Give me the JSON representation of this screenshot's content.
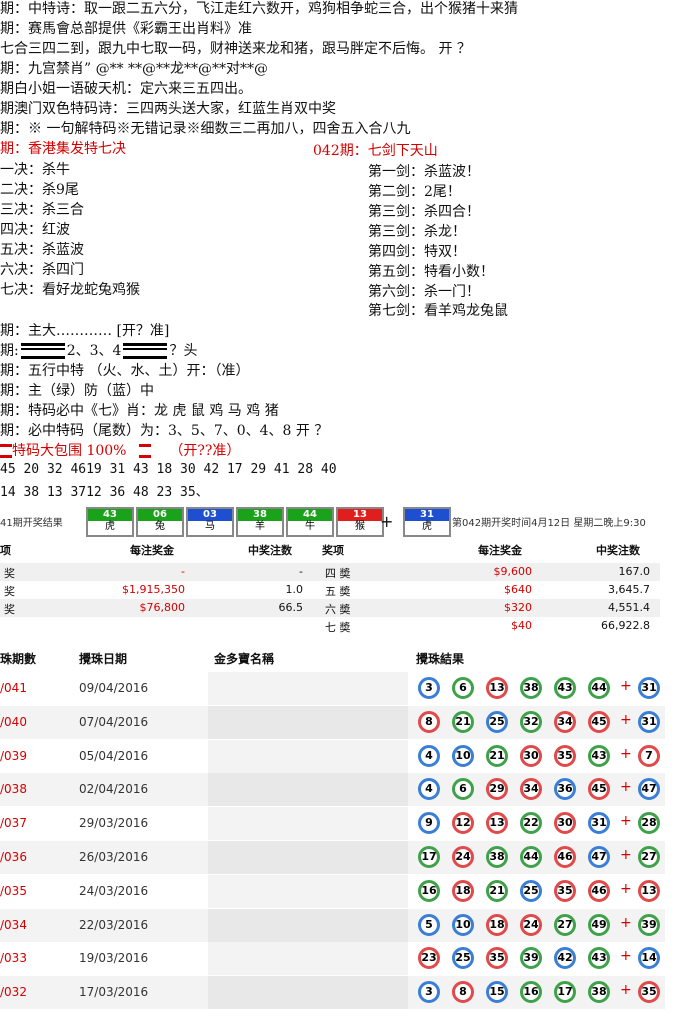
{
  "prediction_lines": [
    {
      "text": "期：中特诗：取一跟二五六分，飞江走红六数开，鸡狗相争蛇三合，出个猴猪十来猜",
      "red": false
    },
    {
      "text": "期：赛馬會总部提供《彩霸王出肖料》准",
      "red": false
    },
    {
      "text": "七合三四二到，跟九中七取一码，财神送来龙和猪，跟马胖定不后悔。 开 ？",
      "red": false
    },
    {
      "text": "期：九宫禁肖” @** **@**龙**@**对**@",
      "red": false
    },
    {
      "text": "期白小姐一语破天机：定六来三五四出。",
      "red": false
    },
    {
      "text": "期澳门双色特码诗：三四两头送大家，红蓝生肖双中奖",
      "red": false
    },
    {
      "text": "期：※ 一句解特码※无错记录※细数三二再加八，四舍五入合八九",
      "red": false
    }
  ],
  "seven_jue": {
    "title_left": "期：香港集发特七决",
    "title_right": "042期：七剑下天山",
    "left": [
      "一决：杀牛",
      "二决：杀9尾",
      "三决：杀三合",
      "四决：红波",
      "五决：杀蓝波",
      "六决：杀四门",
      "七决：看好龙蛇兔鸡猴"
    ],
    "right": [
      "第一剑：杀蓝波！",
      "第二剑：2尾！",
      "第三剑：杀四合！",
      "第三剑：杀龙！",
      "第四剑：特双！",
      "第五剑：特看小数！",
      "第六剑：杀一门！",
      "第七剑：看羊鸡龙兔鼠"
    ]
  },
  "extra_lines": {
    "l1": "期：主大………… [开？准]",
    "l2a": "期:",
    "l2b": "2、3、4",
    "l2c": "？头",
    "l3": "期：五行中特  （火、水、土）开：（准）",
    "l4": "期：主（绿）防（蓝）中",
    "l5": "期：特码必中《七》肖：龙 虎 鼠 鸡 马 鸡 猪",
    "l6": "期：必中特码（尾数）为：3、5、7、0、4、8  开 ？",
    "l7a": "特码大包围 100%",
    "l7b": "（开??准）",
    "nums1": "45 20 32 4619 31 43 18 30 42 17 29 41 28 40",
    "nums2": "14 38 13 3712 36 48 23 35、"
  },
  "result_bar": {
    "label": "41期开奖结果",
    "balls": [
      {
        "num": "43",
        "zodiac": "虎",
        "color": "#1aa31a"
      },
      {
        "num": "06",
        "zodiac": "兔",
        "color": "#1aa31a"
      },
      {
        "num": "03",
        "zodiac": "马",
        "color": "#1e4fd0"
      },
      {
        "num": "38",
        "zodiac": "羊",
        "color": "#1aa31a"
      },
      {
        "num": "44",
        "zodiac": "牛",
        "color": "#1aa31a"
      },
      {
        "num": "13",
        "zodiac": "猴",
        "color": "#e01e1e"
      }
    ],
    "special": {
      "num": "31",
      "zodiac": "虎",
      "color": "#1e4fd0"
    },
    "plus": "+",
    "next_draw": "第042期开奖时间4月12日 星期二晚上9:30"
  },
  "prize_table": {
    "headers": [
      "项",
      "每注奖金",
      "中奖注数",
      "奖项",
      "每注奖金",
      "中奖注数"
    ],
    "rows": [
      {
        "a": "奖",
        "b": "-",
        "c": "-",
        "d": "四 奬",
        "e": "$9,600",
        "f": "167.0"
      },
      {
        "a": "奖",
        "b": "$1,915,350",
        "c": "1.0",
        "d": "五 奬",
        "e": "$640",
        "f": "3,645.7"
      },
      {
        "a": "奖",
        "b": "$76,800",
        "c": "66.5",
        "d": "六 奬",
        "e": "$320",
        "f": "4,551.4"
      },
      {
        "a": "",
        "b": "",
        "c": "",
        "d": "七 奬",
        "e": "$40",
        "f": "66,922.8"
      }
    ]
  },
  "history": {
    "headers": [
      "珠期數",
      "攪珠日期",
      "金多寶名稱",
      "攪珠結果"
    ],
    "rows": [
      {
        "period": "/041",
        "date": "09/04/2016",
        "balls": [
          {
            "n": "3",
            "c": "blue"
          },
          {
            "n": "6",
            "c": "green"
          },
          {
            "n": "13",
            "c": "red"
          },
          {
            "n": "38",
            "c": "green"
          },
          {
            "n": "43",
            "c": "green"
          },
          {
            "n": "44",
            "c": "green"
          }
        ],
        "special": {
          "n": "31",
          "c": "blue"
        }
      },
      {
        "period": "/040",
        "date": "07/04/2016",
        "balls": [
          {
            "n": "8",
            "c": "red"
          },
          {
            "n": "21",
            "c": "green"
          },
          {
            "n": "25",
            "c": "blue"
          },
          {
            "n": "32",
            "c": "green"
          },
          {
            "n": "34",
            "c": "red"
          },
          {
            "n": "45",
            "c": "red"
          }
        ],
        "special": {
          "n": "31",
          "c": "blue"
        }
      },
      {
        "period": "/039",
        "date": "05/04/2016",
        "balls": [
          {
            "n": "4",
            "c": "blue"
          },
          {
            "n": "10",
            "c": "blue"
          },
          {
            "n": "21",
            "c": "green"
          },
          {
            "n": "30",
            "c": "red"
          },
          {
            "n": "35",
            "c": "red"
          },
          {
            "n": "43",
            "c": "green"
          }
        ],
        "special": {
          "n": "7",
          "c": "red"
        }
      },
      {
        "period": "/038",
        "date": "02/04/2016",
        "balls": [
          {
            "n": "4",
            "c": "blue"
          },
          {
            "n": "6",
            "c": "green"
          },
          {
            "n": "29",
            "c": "red"
          },
          {
            "n": "34",
            "c": "red"
          },
          {
            "n": "36",
            "c": "blue"
          },
          {
            "n": "45",
            "c": "red"
          }
        ],
        "special": {
          "n": "47",
          "c": "blue"
        }
      },
      {
        "period": "/037",
        "date": "29/03/2016",
        "balls": [
          {
            "n": "9",
            "c": "blue"
          },
          {
            "n": "12",
            "c": "red"
          },
          {
            "n": "13",
            "c": "red"
          },
          {
            "n": "22",
            "c": "green"
          },
          {
            "n": "30",
            "c": "red"
          },
          {
            "n": "31",
            "c": "blue"
          }
        ],
        "special": {
          "n": "28",
          "c": "green"
        }
      },
      {
        "period": "/036",
        "date": "26/03/2016",
        "balls": [
          {
            "n": "17",
            "c": "green"
          },
          {
            "n": "24",
            "c": "red"
          },
          {
            "n": "38",
            "c": "green"
          },
          {
            "n": "44",
            "c": "green"
          },
          {
            "n": "46",
            "c": "red"
          },
          {
            "n": "47",
            "c": "blue"
          }
        ],
        "special": {
          "n": "27",
          "c": "green"
        }
      },
      {
        "period": "/035",
        "date": "24/03/2016",
        "balls": [
          {
            "n": "16",
            "c": "green"
          },
          {
            "n": "18",
            "c": "red"
          },
          {
            "n": "21",
            "c": "green"
          },
          {
            "n": "25",
            "c": "blue"
          },
          {
            "n": "35",
            "c": "red"
          },
          {
            "n": "46",
            "c": "red"
          }
        ],
        "special": {
          "n": "13",
          "c": "red"
        }
      },
      {
        "period": "/034",
        "date": "22/03/2016",
        "balls": [
          {
            "n": "5",
            "c": "blue"
          },
          {
            "n": "10",
            "c": "blue"
          },
          {
            "n": "18",
            "c": "red"
          },
          {
            "n": "24",
            "c": "red"
          },
          {
            "n": "27",
            "c": "green"
          },
          {
            "n": "49",
            "c": "green"
          }
        ],
        "special": {
          "n": "39",
          "c": "green"
        }
      },
      {
        "period": "/033",
        "date": "19/03/2016",
        "balls": [
          {
            "n": "23",
            "c": "red"
          },
          {
            "n": "25",
            "c": "blue"
          },
          {
            "n": "35",
            "c": "red"
          },
          {
            "n": "39",
            "c": "green"
          },
          {
            "n": "42",
            "c": "blue"
          },
          {
            "n": "43",
            "c": "green"
          }
        ],
        "special": {
          "n": "14",
          "c": "blue"
        }
      },
      {
        "period": "/032",
        "date": "17/03/2016",
        "balls": [
          {
            "n": "3",
            "c": "blue"
          },
          {
            "n": "8",
            "c": "red"
          },
          {
            "n": "15",
            "c": "blue"
          },
          {
            "n": "16",
            "c": "green"
          },
          {
            "n": "17",
            "c": "green"
          },
          {
            "n": "38",
            "c": "green"
          }
        ],
        "special": {
          "n": "35",
          "c": "red"
        }
      }
    ]
  }
}
